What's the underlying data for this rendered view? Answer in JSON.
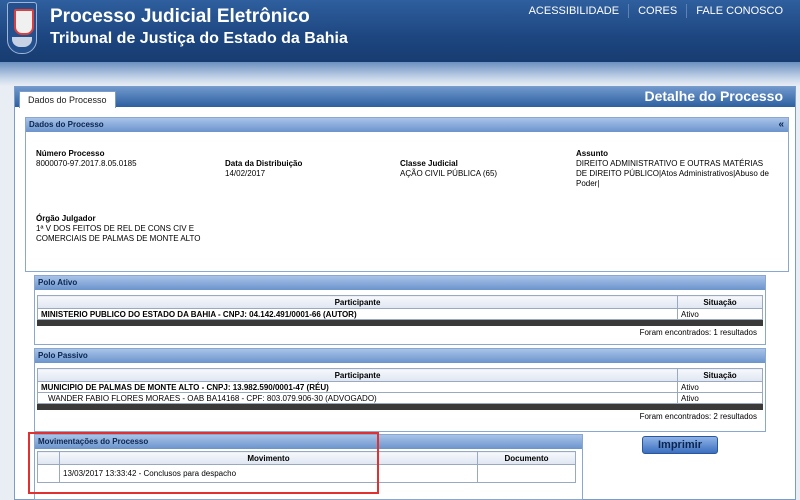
{
  "header": {
    "title": "Processo Judicial Eletrônico",
    "subtitle": "Tribunal de Justiça do Estado da Bahia",
    "nav": [
      "ACESSIBILIDADE",
      "CORES",
      "FALE CONOSCO"
    ]
  },
  "panel": {
    "tab_label": "Dados do Processo",
    "title": "Detalhe do Processo"
  },
  "dados": {
    "section_title": "Dados do Processo",
    "collapse_symbol": "«",
    "numero_label": "Número Processo",
    "numero_value": "8000070-97.2017.8.05.0185",
    "data_label": "Data da Distribuição",
    "data_value": "14/02/2017",
    "classe_label": "Classe Judicial",
    "classe_value": "AÇÃO CIVIL PÚBLICA (65)",
    "assunto_label": "Assunto",
    "assunto_value": "DIREITO ADMINISTRATIVO E OUTRAS MATÉRIAS DE DIREITO PÚBLICO|Atos Administrativos|Abuso de Poder|",
    "orgao_label": "Órgão Julgador",
    "orgao_value": "1ª V DOS FEITOS DE REL DE CONS CIV E COMERCIAIS DE PALMAS DE MONTE ALTO"
  },
  "polo_ativo": {
    "section_title": "Polo Ativo",
    "columns": [
      "Participante",
      "Situação"
    ],
    "rows": [
      {
        "participante": "MINISTERIO PUBLICO DO ESTADO DA BAHIA - CNPJ: 04.142.491/0001-66 (AUTOR)",
        "situacao": "Ativo"
      }
    ],
    "count": "Foram encontrados: 1 resultados"
  },
  "polo_passivo": {
    "section_title": "Polo Passivo",
    "columns": [
      "Participante",
      "Situação"
    ],
    "rows": [
      {
        "participante": "MUNICIPIO DE PALMAS DE MONTE ALTO - CNPJ: 13.982.590/0001-47 (RÉU)",
        "situacao": "Ativo"
      },
      {
        "participante": "WANDER FABIO FLORES MORAES - OAB BA14168 - CPF: 803.079.906-30 (ADVOGADO)",
        "situacao": "Ativo"
      }
    ],
    "count": "Foram encontrados: 2 resultados"
  },
  "movimentacoes": {
    "section_title": "Movimentações do Processo",
    "columns": [
      "Movimento",
      "Documento"
    ],
    "rows": [
      {
        "movimento": "13/03/2017 13:33:42 - Conclusos para despacho",
        "documento": ""
      }
    ]
  },
  "print_button": "Imprimir",
  "colors": {
    "header": "#1d4680",
    "highlight": "#e0302f",
    "section_head": "#6b94cc"
  }
}
